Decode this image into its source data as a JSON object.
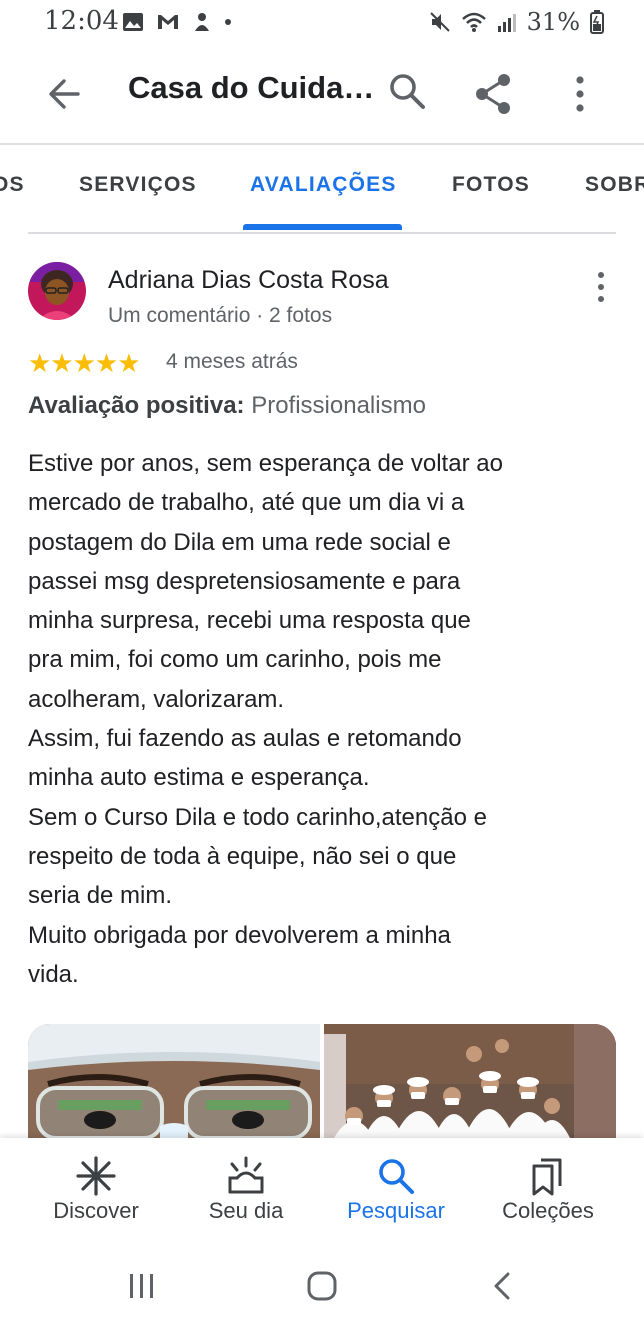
{
  "status_bar": {
    "time": "12:04",
    "battery": "31%"
  },
  "app_bar": {
    "title": "Casa do Cuida…"
  },
  "tabs": [
    {
      "label": "OS"
    },
    {
      "label": "SERVIÇOS"
    },
    {
      "label": "AVALIAÇÕES",
      "active": true
    },
    {
      "label": "FOTOS"
    },
    {
      "label": "SOBRE"
    }
  ],
  "review": {
    "author": "Adriana Dias Costa Rosa",
    "meta": "Um comentário · 2 fotos",
    "rating": 5,
    "stars": "★★★★★",
    "time": "4 meses atrás",
    "aspect_label": "Avaliação positiva:",
    "aspect_value": "Profissionalismo",
    "lines": [
      "Estive por anos, sem esperança de voltar ao",
      "mercado de trabalho, até que um dia vi a",
      "postagem do Dila em uma rede social e",
      "passei msg despretensiosamente e para",
      "minha surpresa, recebi uma resposta que",
      "pra mim, foi como um carinho, pois me",
      "acolheram, valorizaram.",
      "Assim, fui fazendo as aulas e retomando",
      "minha auto estima e esperança.",
      "Sem o Curso Dila e todo carinho,atenção e",
      "respeito de toda à equipe, não sei o que",
      "seria de mim.",
      "Muito obrigada por devolverem a minha",
      "vida."
    ]
  },
  "bottom_nav": [
    {
      "label": "Discover",
      "icon": "asterisk-icon"
    },
    {
      "label": "Seu dia",
      "icon": "sunrise-icon"
    },
    {
      "label": "Pesquisar",
      "icon": "search-icon",
      "active": true
    },
    {
      "label": "Coleções",
      "icon": "bookmarks-icon"
    }
  ],
  "colors": {
    "accent": "#1a73e8",
    "star": "#fbbc04",
    "text": "#202124",
    "secondary": "#5f6368"
  }
}
